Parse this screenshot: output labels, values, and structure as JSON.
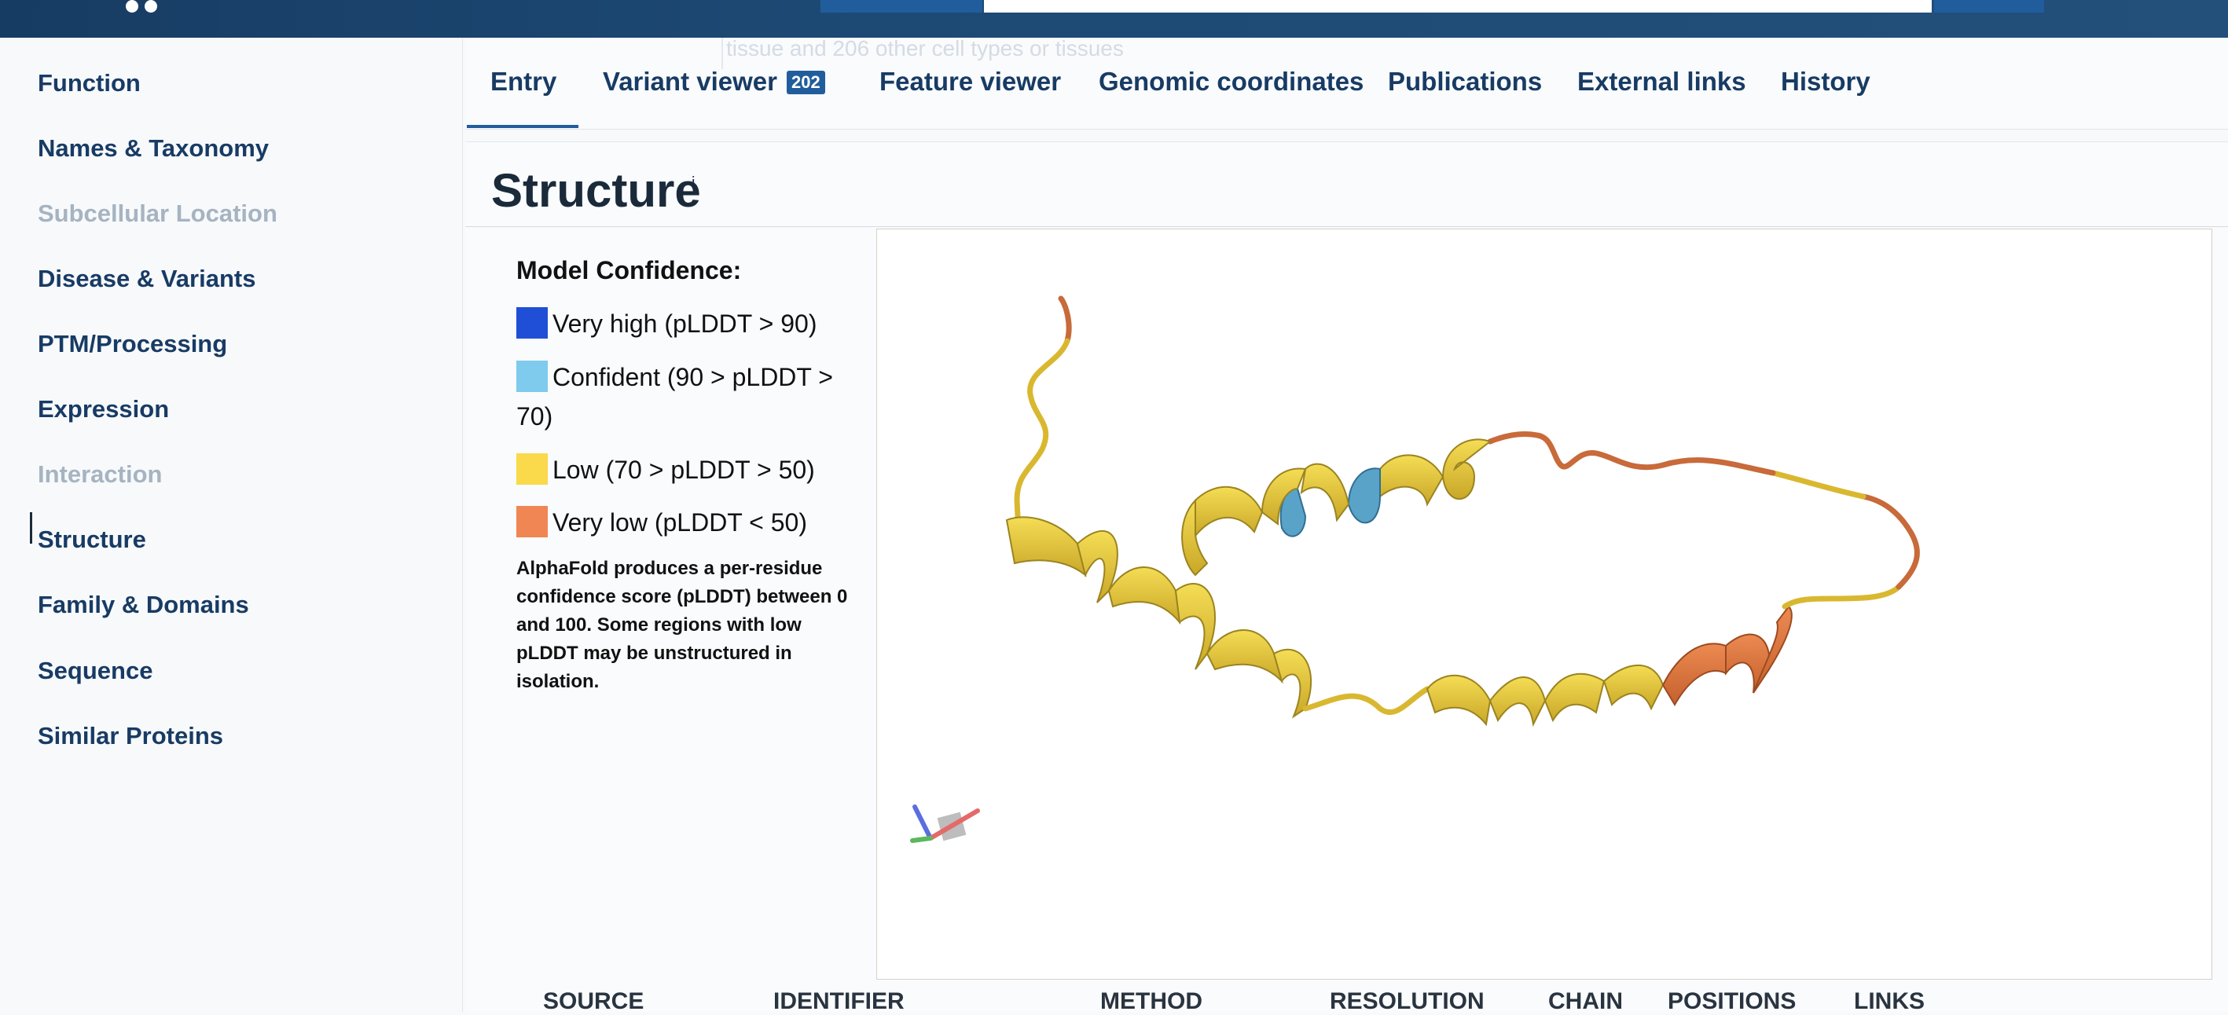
{
  "header": {
    "search": {
      "value": "",
      "placeholder": ""
    }
  },
  "sidebar": {
    "items": [
      {
        "label": "Function",
        "enabled": true
      },
      {
        "label": "Names & Taxonomy",
        "enabled": true
      },
      {
        "label": "Subcellular Location",
        "enabled": false
      },
      {
        "label": "Disease & Variants",
        "enabled": true
      },
      {
        "label": "PTM/Processing",
        "enabled": true
      },
      {
        "label": "Expression",
        "enabled": true
      },
      {
        "label": "Interaction",
        "enabled": false
      },
      {
        "label": "Structure",
        "enabled": true,
        "active": true
      },
      {
        "label": "Family & Domains",
        "enabled": true
      },
      {
        "label": "Sequence",
        "enabled": true
      },
      {
        "label": "Similar Proteins",
        "enabled": true
      }
    ]
  },
  "overlay": {
    "ghost_text": "tissue and 206 other cell types or tissues"
  },
  "tabs": [
    {
      "label": "Entry",
      "active": true
    },
    {
      "label": "Variant viewer",
      "badge": "202"
    },
    {
      "label": "Feature viewer"
    },
    {
      "label": "Genomic coordinates"
    },
    {
      "label": "Publications"
    },
    {
      "label": "External links"
    },
    {
      "label": "History"
    }
  ],
  "section": {
    "title": "Structure",
    "info_mark": "i"
  },
  "legend": {
    "title": "Model Confidence:",
    "items": [
      {
        "label": "Very high (pLDDT > 90)",
        "color": "#1f4fd6"
      },
      {
        "label": "Confident (90 > pLDDT > 70)",
        "color": "#7ecbee"
      },
      {
        "label": "Low (70 > pLDDT > 50)",
        "color": "#fad94a"
      },
      {
        "label": "Very low (pLDDT < 50)",
        "color": "#f08653"
      }
    ],
    "note": "AlphaFold produces a per-residue confidence score (pLDDT) between 0 and 100. Some regions with low pLDDT may be unstructured in isolation."
  },
  "colors": {
    "brand_dark": "#173c63",
    "link": "#183b64",
    "accent": "#215d9c",
    "disabled": "#a6b3c1"
  },
  "table": {
    "headers": [
      "SOURCE",
      "IDENTIFIER",
      "METHOD",
      "RESOLUTION",
      "CHAIN",
      "POSITIONS",
      "LINKS"
    ]
  }
}
